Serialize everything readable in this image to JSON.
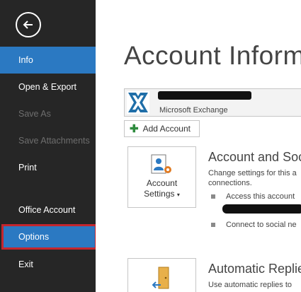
{
  "sidebar": {
    "back_icon": "back-arrow-circle-icon",
    "items": [
      {
        "label": "Info",
        "state": "active"
      },
      {
        "label": "Open & Export",
        "state": "normal"
      },
      {
        "label": "Save As",
        "state": "disabled"
      },
      {
        "label": "Save Attachments",
        "state": "disabled"
      },
      {
        "label": "Print",
        "state": "normal"
      },
      {
        "label": "Office Account",
        "state": "normal"
      },
      {
        "label": "Options",
        "state": "highlighted"
      },
      {
        "label": "Exit",
        "state": "normal"
      }
    ]
  },
  "main": {
    "title": "Account Inform",
    "account": {
      "type": "Microsoft Exchange",
      "icon": "exchange-icon"
    },
    "add_account": {
      "label": "Add Account",
      "icon": "plus-icon"
    },
    "account_settings": {
      "tile_label_line1": "Account",
      "tile_label_line2": "Settings",
      "heading": "Account and Soc",
      "desc_line1": "Change settings for this a",
      "desc_line2": "connections.",
      "bullet1": "Access this account",
      "bullet2": "Connect to social ne"
    },
    "automatic_replies": {
      "heading": "Automatic Replie",
      "desc_line1": "Use automatic replies to"
    }
  },
  "colors": {
    "sidebar_bg": "#262626",
    "accent_blue": "#2b79c2",
    "highlight_red": "#c4262e"
  }
}
